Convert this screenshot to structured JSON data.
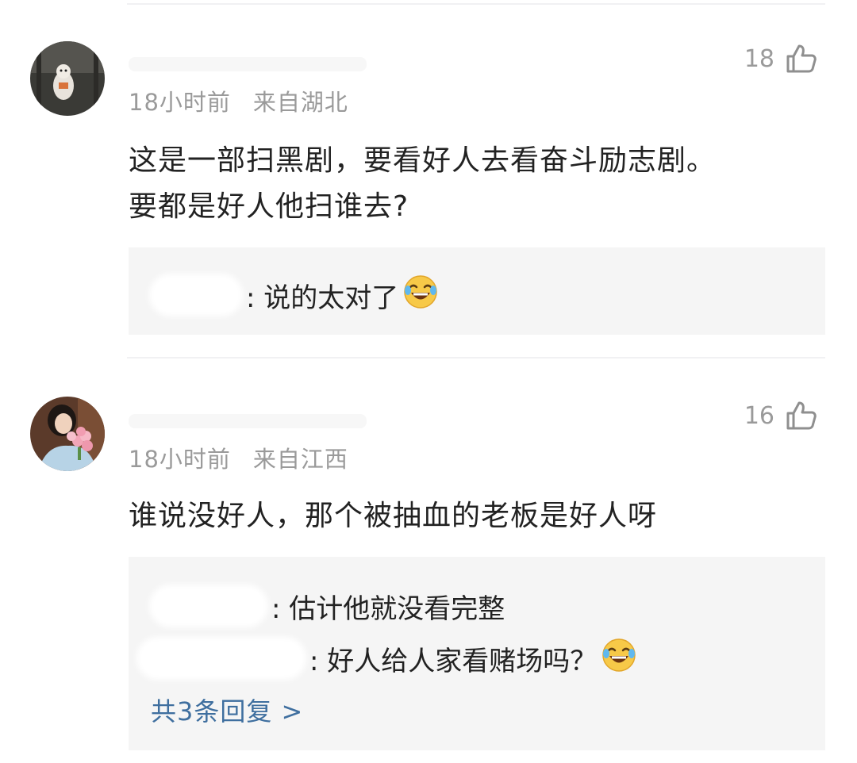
{
  "comments": [
    {
      "likes": "18",
      "time": "18小时前",
      "location": "来自湖北",
      "text_line1": "这是一部扫黑剧，要看好人去看奋斗励志剧。",
      "text_line2": "要都是好人他扫谁去?",
      "replies": [
        {
          "text": ": 说的太对了",
          "emoji": "laughing-tears-icon"
        }
      ]
    },
    {
      "likes": "16",
      "time": "18小时前",
      "location": "来自江西",
      "text_line1": "谁说没好人，那个被抽血的老板是好人呀",
      "replies": [
        {
          "text": ": 估计他就没看完整"
        },
        {
          "text": ": 好人给人家看赌场吗？",
          "emoji": "laughing-tears-icon"
        }
      ],
      "more_replies": "共3条回复 >"
    }
  ],
  "colors": {
    "meta": "#9a9a9a",
    "text": "#222222",
    "reply_bg": "#f5f5f5",
    "link": "#3f6f9f"
  }
}
